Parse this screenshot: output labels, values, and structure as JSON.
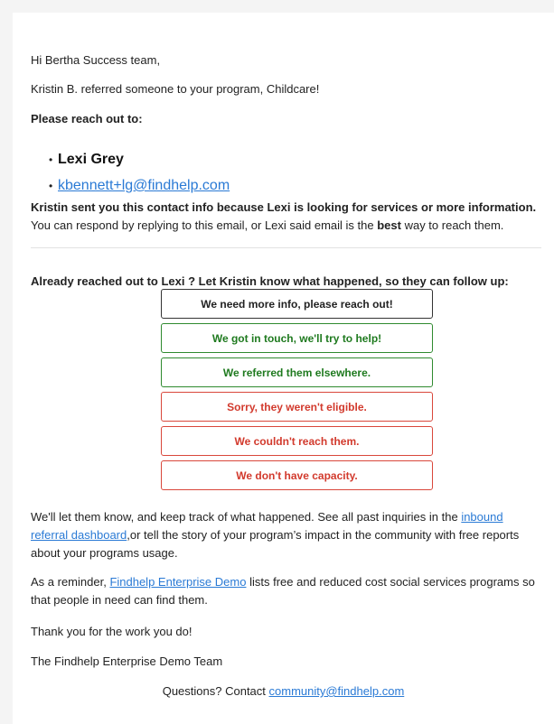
{
  "greeting": "Hi Bertha Success team,",
  "referral_line": "Kristin B. referred someone to your program, Childcare!",
  "reach_out_heading": "Please reach out to:",
  "contact": {
    "name": "Lexi Grey",
    "email": "kbennett+lg@findhelp.com"
  },
  "info": {
    "bold_part": "Kristin sent you this contact info because Lexi is looking for services or more information.",
    "part1": " You can respond by replying to this email, or Lexi said email is the ",
    "best": "best",
    "part2": " way to reach them."
  },
  "already_heading": "Already reached out to Lexi ? Let Kristin know what happened, so they can follow up:",
  "buttons": [
    {
      "label": "We need more info, please reach out!",
      "tone": "neutral"
    },
    {
      "label": "We got in touch, we'll try to help!",
      "tone": "green"
    },
    {
      "label": "We referred them elsewhere.",
      "tone": "green"
    },
    {
      "label": "Sorry, they weren't eligible.",
      "tone": "red"
    },
    {
      "label": "We couldn't reach them.",
      "tone": "red"
    },
    {
      "label": "We don't have capacity.",
      "tone": "red"
    }
  ],
  "track": {
    "part1": "We'll let them know, and keep track of what happened. See all past inquiries in the ",
    "link": "inbound referral dashboard",
    "part2": ",or tell the story of your program’s impact in the community with free reports about your programs usage."
  },
  "reminder": {
    "part1": "As a reminder, ",
    "link": "Findhelp Enterprise Demo",
    "part2": " lists free and reduced cost social services programs so that people in need can find them."
  },
  "thanks": "Thank you for the work you do!",
  "team": "The Findhelp Enterprise Demo Team",
  "questions": {
    "part1": "Questions? Contact ",
    "link": "community@findhelp.com"
  },
  "colors": {
    "link": "#2a7ad5",
    "green": "#1f7a1f",
    "red": "#d23a2d",
    "page_bg": "#f4f4f4"
  }
}
